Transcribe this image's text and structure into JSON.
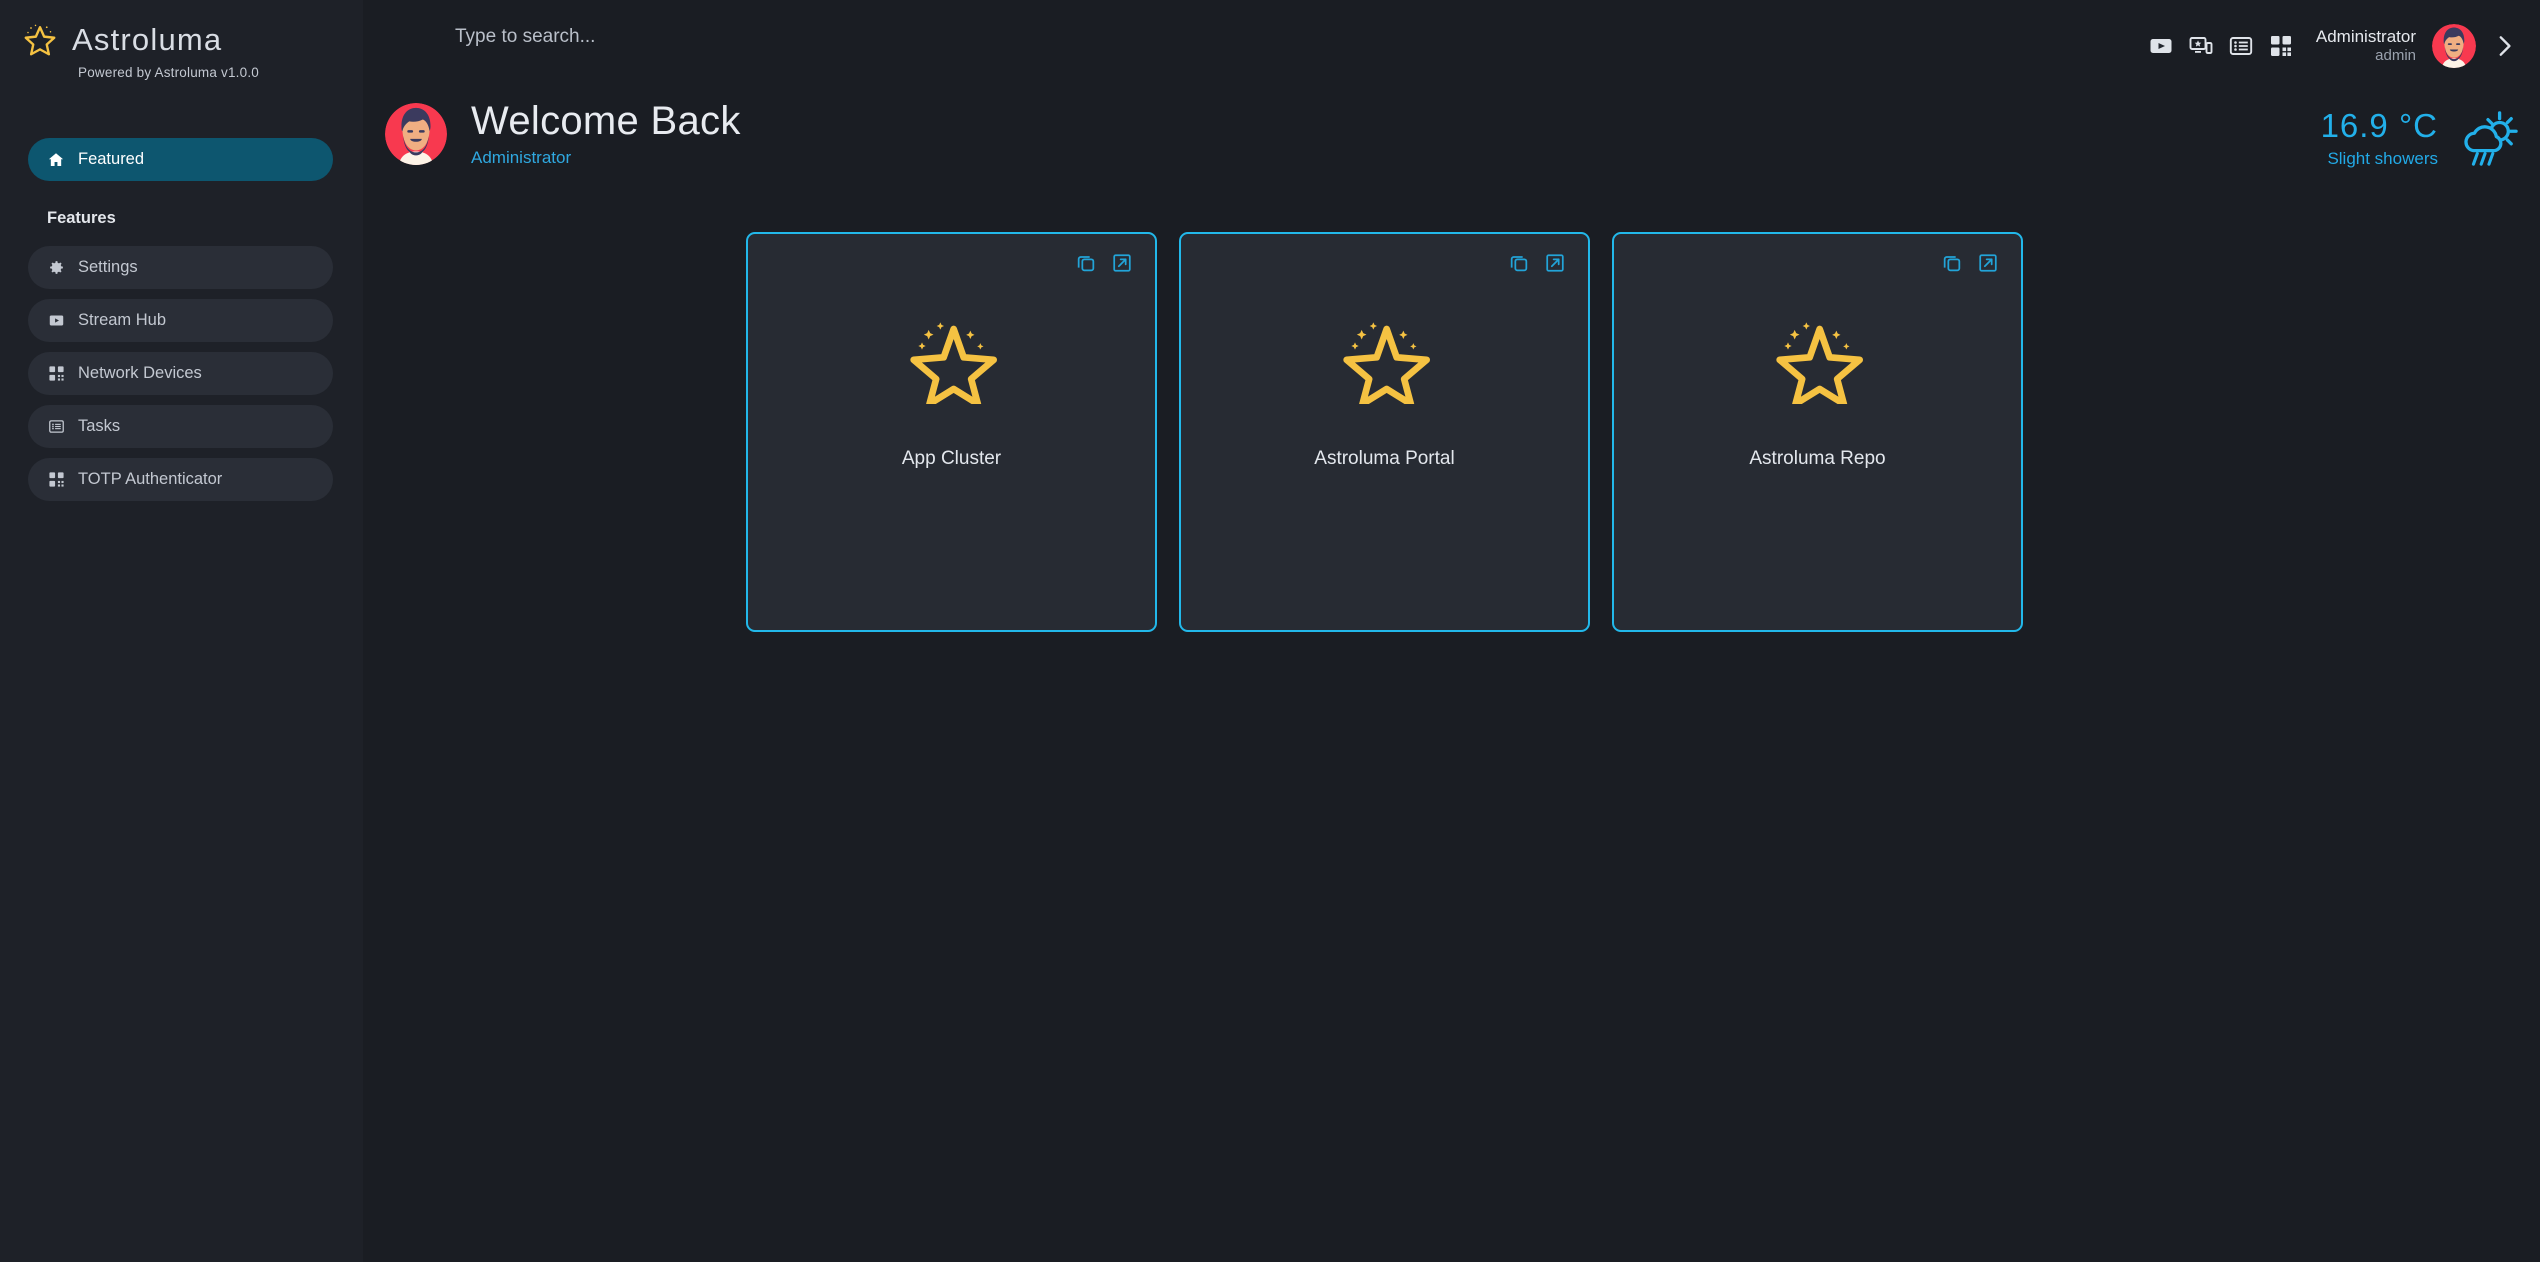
{
  "brand": {
    "name": "Astroluma",
    "subtitle": "Powered by Astroluma v1.0.0",
    "logo_icon": "star-sparkle-icon"
  },
  "sidebar": {
    "active_item": {
      "label": "Featured",
      "icon": "home-icon"
    },
    "section_label": "Features",
    "items": [
      {
        "label": "Settings",
        "icon": "gear-icon"
      },
      {
        "label": "Stream Hub",
        "icon": "play-box-icon"
      },
      {
        "label": "Network Devices",
        "icon": "qr-code-icon"
      },
      {
        "label": "Tasks",
        "icon": "list-icon"
      },
      {
        "label": "TOTP Authenticator",
        "icon": "qr-code-icon"
      }
    ]
  },
  "search": {
    "placeholder": "Type to search...",
    "value": ""
  },
  "header": {
    "icons": [
      {
        "name": "video-play-icon"
      },
      {
        "name": "cast-screen-icon"
      },
      {
        "name": "list-view-icon"
      },
      {
        "name": "qr-scan-icon"
      }
    ],
    "user_name": "Administrator",
    "user_role": "admin",
    "avatar_icon": "user-avatar",
    "expand_icon": "chevron-right-icon"
  },
  "welcome": {
    "avatar_icon": "user-avatar",
    "title": "Welcome Back",
    "subtitle": "Administrator"
  },
  "weather": {
    "temperature": "16.9 °C",
    "condition": "Slight showers",
    "icon": "sun-rain-cloud-icon"
  },
  "cards": [
    {
      "label": "App Cluster",
      "icon": "star-sparkle-icon",
      "copy_icon": "copy-icon",
      "open_icon": "external-link-icon"
    },
    {
      "label": "Astroluma Portal",
      "icon": "star-sparkle-icon",
      "copy_icon": "copy-icon",
      "open_icon": "external-link-icon"
    },
    {
      "label": "Astroluma Repo",
      "icon": "star-sparkle-icon",
      "copy_icon": "copy-icon",
      "open_icon": "external-link-icon"
    }
  ],
  "colors": {
    "accent_cyan": "#22b8ea",
    "active_nav": "#0d566f",
    "star_yellow": "#f5c242",
    "sidebar_bg": "#1e2128",
    "main_bg": "#1a1d23",
    "card_bg": "#272b33",
    "avatar_red": "#f8394f"
  }
}
